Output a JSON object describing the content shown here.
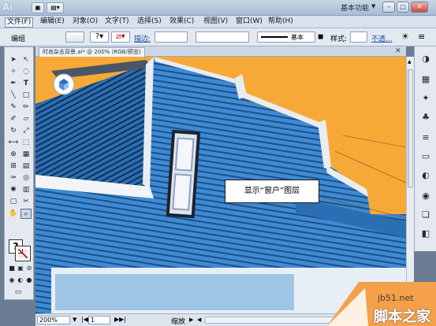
{
  "app": {
    "logo": "Ai",
    "workspace": "基本功能"
  },
  "menu": [
    "文件(F)",
    "编辑(E)",
    "对象(O)",
    "文字(T)",
    "选择(S)",
    "效果(C)",
    "视图(V)",
    "窗口(W)",
    "帮助(H)"
  ],
  "options": {
    "selection": "编组",
    "stroke_label": "描边:",
    "stroke_value": "",
    "brush_label": "基本",
    "style_label": "样式:",
    "opacity_label": "不透..."
  },
  "document": {
    "tab_title": "时尚杂志背景.ai* @ 200% (RGB/预览)"
  },
  "status": {
    "zoom": "200%",
    "page": "1",
    "info": "缩放"
  },
  "callout": "显示“窗户”图层",
  "watermark": {
    "domain": "jb51.net",
    "name": "脚本之家"
  },
  "colors": {
    "background": "#f7a938",
    "siding": "#3d8bd6",
    "accent": "#1b2433"
  }
}
